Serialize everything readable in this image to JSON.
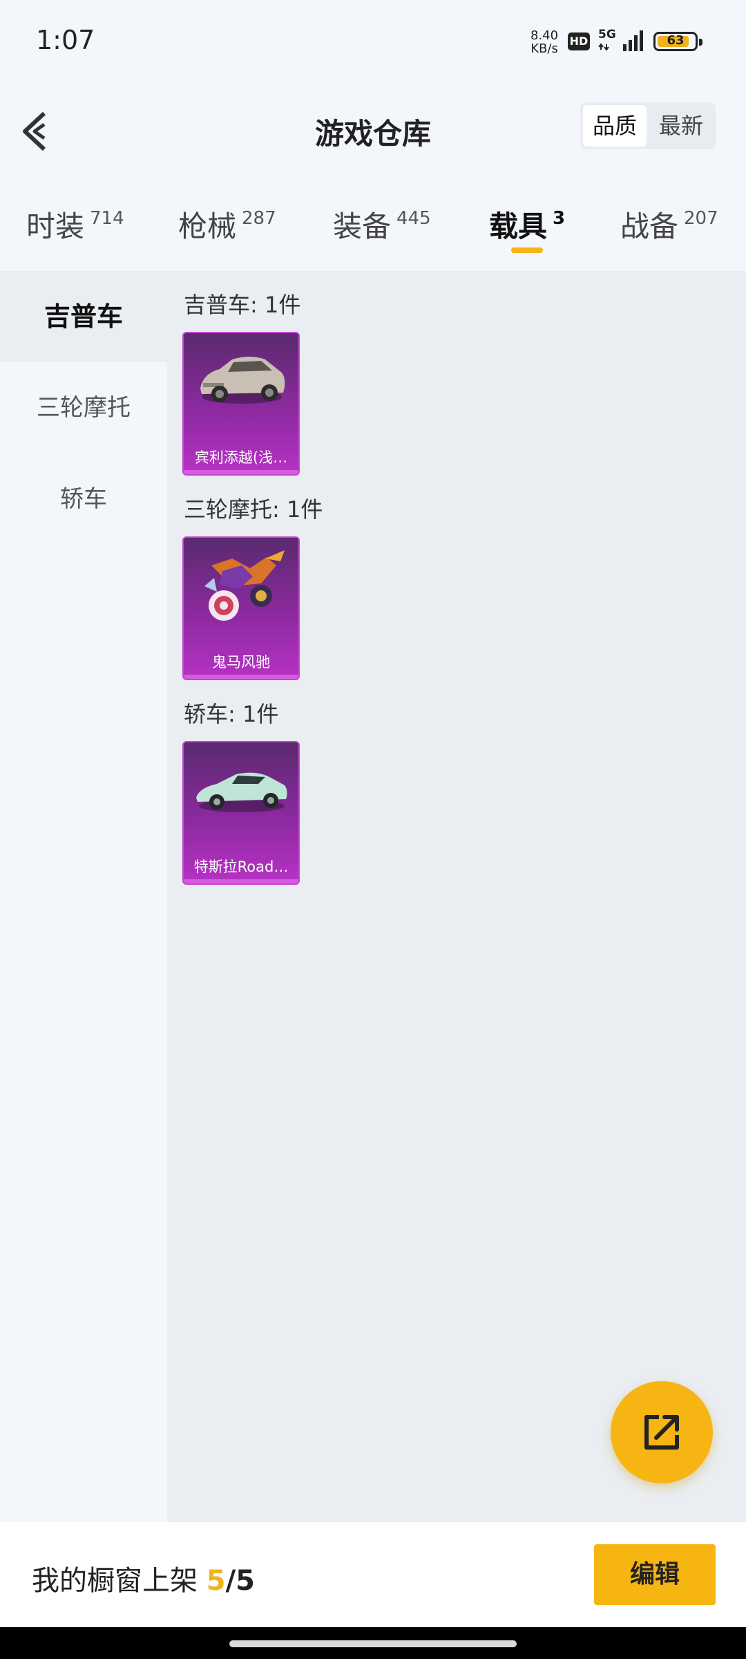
{
  "status": {
    "time": "1:07",
    "net_speed_value": "8.40",
    "net_speed_unit": "KB/s",
    "hd": "HD",
    "network": "5G",
    "battery": "63"
  },
  "header": {
    "title": "游戏仓库",
    "sort_options": [
      "品质",
      "最新"
    ]
  },
  "tabs": [
    {
      "label": "时装",
      "count": "714"
    },
    {
      "label": "枪械",
      "count": "287"
    },
    {
      "label": "装备",
      "count": "445"
    },
    {
      "label": "载具",
      "count": "3"
    },
    {
      "label": "战备",
      "count": "207"
    }
  ],
  "active_tab": "载具",
  "sidebar": {
    "items": [
      "吉普车",
      "三轮摩托",
      "轿车"
    ],
    "active": "吉普车"
  },
  "groups": [
    {
      "title": "吉普车: 1件",
      "item": {
        "name": "宾利添越(浅…",
        "icon": "suv-car-icon"
      }
    },
    {
      "title": "三轮摩托: 1件",
      "item": {
        "name": "鬼马风驰",
        "icon": "motorcycle-icon"
      }
    },
    {
      "title": "轿车: 1件",
      "item": {
        "name": "特斯拉Road…",
        "icon": "sports-car-icon"
      }
    }
  ],
  "footer": {
    "label": "我的橱窗上架",
    "current": "5",
    "total": "/5",
    "edit": "编辑"
  },
  "colors": {
    "accent": "#f5b316",
    "card_purple": "#8d2aa0"
  }
}
